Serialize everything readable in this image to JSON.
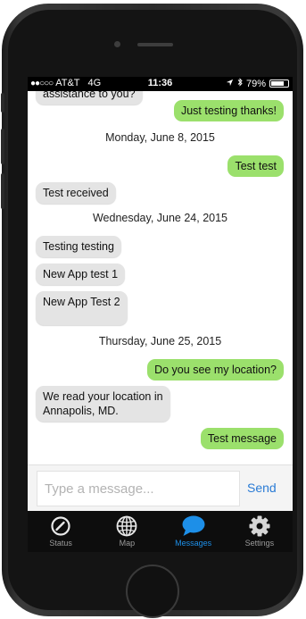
{
  "status_bar": {
    "carrier": "AT&T",
    "network": "4G",
    "time": "11:36",
    "battery": "79%",
    "battery_level": 0.79
  },
  "messages": {
    "partial_top": "assistance to you?",
    "m1": "Just testing thanks!",
    "d1": "Monday, June 8, 2015",
    "m2": "Test test",
    "m3": "Test received",
    "d2": "Wednesday, June 24, 2015",
    "m4": "Testing testing",
    "m5": "New App test 1",
    "m6": "New App Test 2",
    "d3": "Thursday, June 25, 2015",
    "m7": "Do you see my location?",
    "m8_line1": "We read your location in",
    "m8_line2": "Annapolis, MD.",
    "m9": "Test message"
  },
  "composer": {
    "placeholder": "Type a message...",
    "send_label": "Send"
  },
  "tabs": {
    "status": "Status",
    "map": "Map",
    "messages": "Messages",
    "settings": "Settings"
  },
  "colors": {
    "outgoing_bubble": "#9be06c",
    "incoming_bubble": "#e4e4e4",
    "accent": "#1d8fe8"
  }
}
